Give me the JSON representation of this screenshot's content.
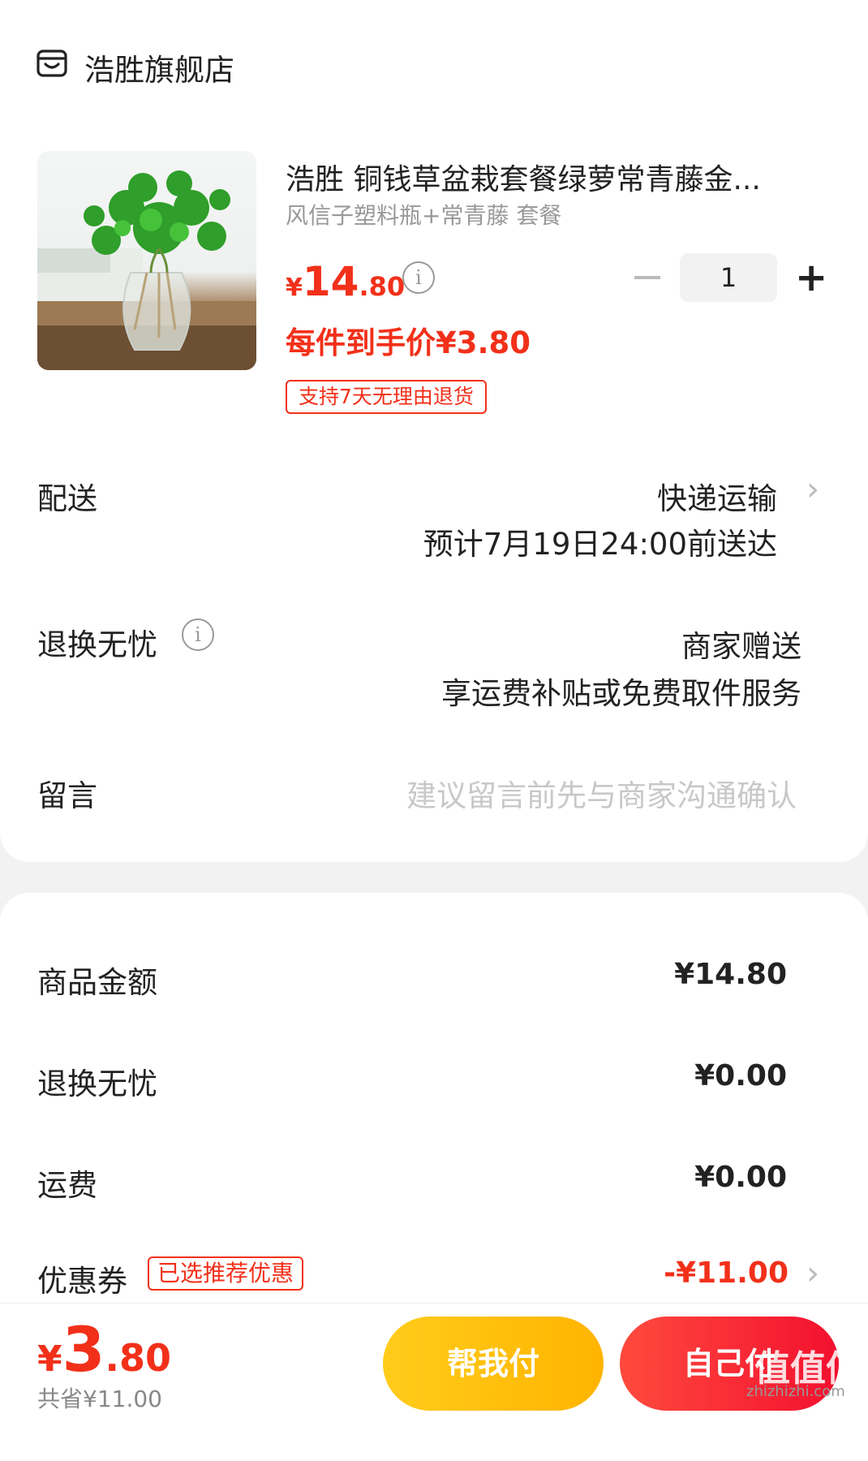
{
  "shop": {
    "name": "浩胜旗舰店",
    "icon": "shop-icon"
  },
  "product": {
    "title": "浩胜 铜钱草盆栽套餐绿萝常青藤金...",
    "spec": "风信子塑料瓶+常青藤 套餐",
    "price_currency": "¥",
    "price_int": "14",
    "price_dec": ".80",
    "unit_price": "每件到手价¥3.80",
    "return_tag": "支持7天无理由退货",
    "quantity": "1",
    "minus_label": "−",
    "plus_label": "+"
  },
  "delivery": {
    "label": "配送",
    "method": "快递运输",
    "eta": "预计7月19日24:00前送达"
  },
  "return_worry": {
    "label": "退换无忧",
    "value": "商家赠送",
    "desc": "享运费补贴或免费取件服务"
  },
  "message": {
    "label": "留言",
    "placeholder": "建议留言前先与商家沟通确认"
  },
  "summary": {
    "goods_label": "商品金额",
    "goods_value": "¥14.80",
    "return_label": "退换无忧",
    "return_value": "¥0.00",
    "shipping_label": "运费",
    "shipping_value": "¥0.00",
    "coupon_label": "优惠券",
    "coupon_tag": "已选推荐优惠",
    "coupon_value": "-¥11.00"
  },
  "footer": {
    "total_currency": "¥",
    "total_int": "3",
    "total_dec": ".80",
    "saved": "共省¥11.00",
    "help_pay": "帮我付",
    "self_pay": "自己付",
    "watermark": "值值值",
    "watermark_url": "zhizhizhi.com"
  },
  "colors": {
    "accent": "#f2301a",
    "help_btn": "#ffc21a",
    "self_btn": "#f4232f"
  }
}
